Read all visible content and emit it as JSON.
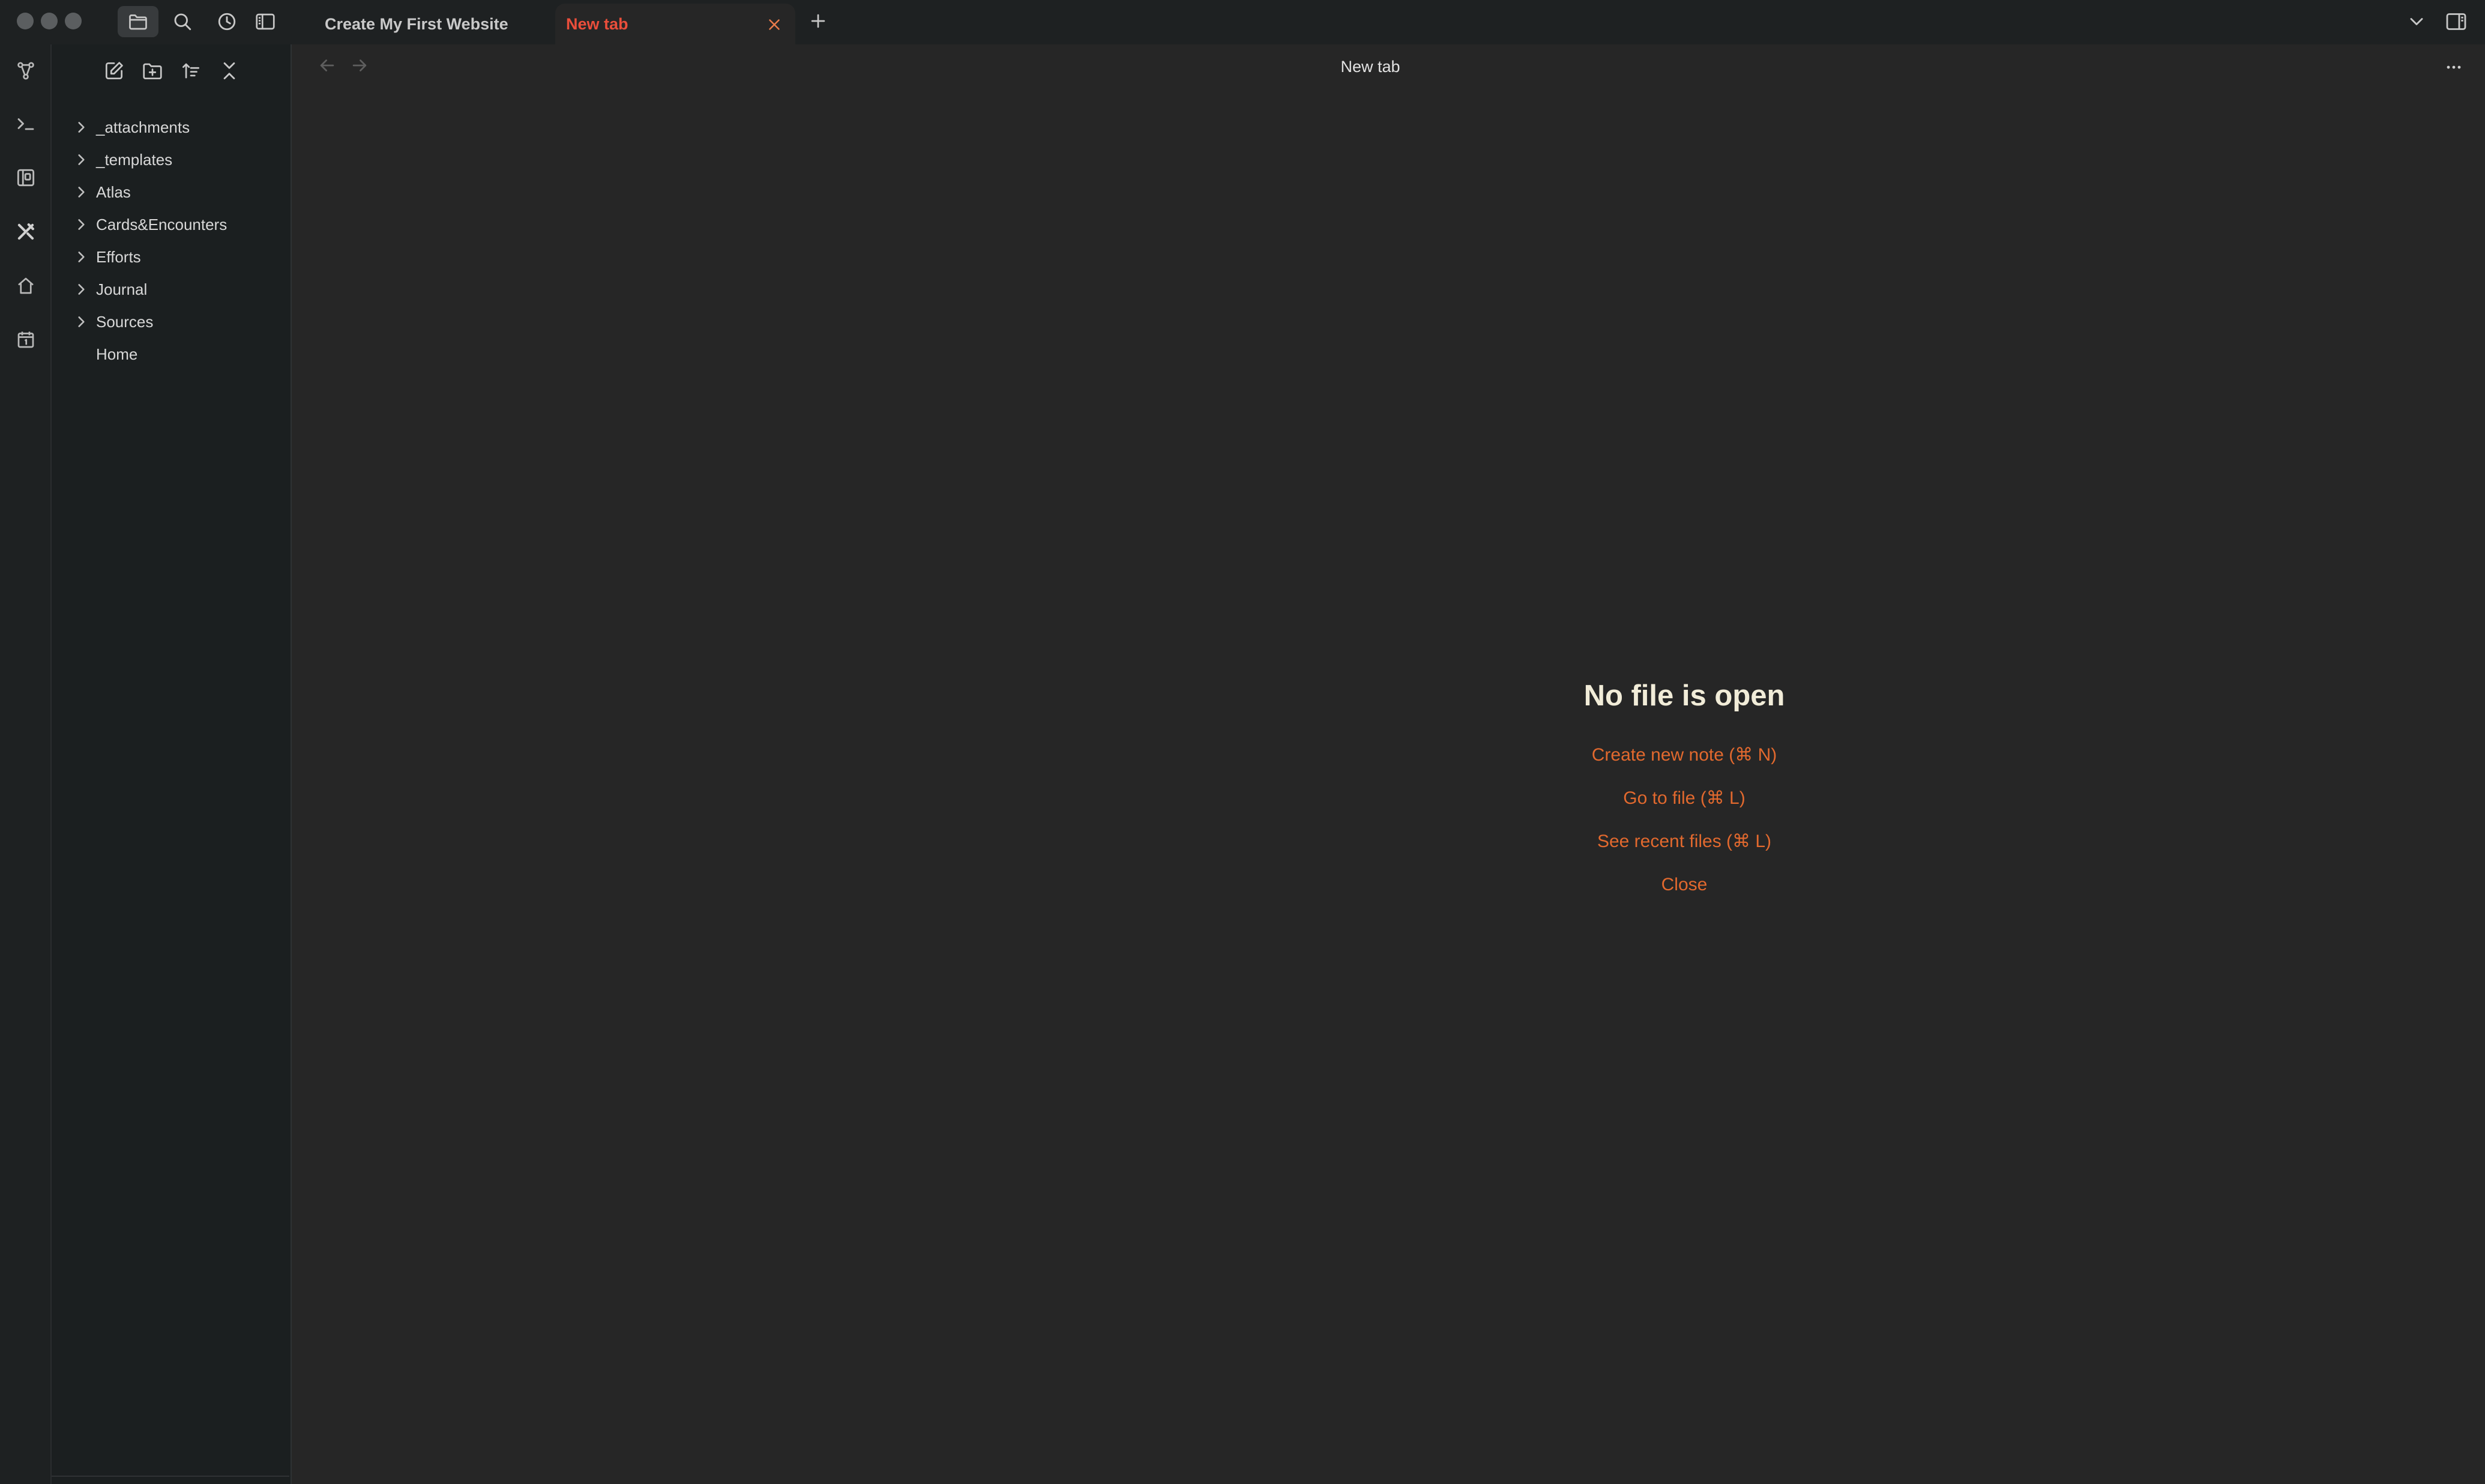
{
  "tabs": [
    {
      "label": "Create My First Website",
      "active": false
    },
    {
      "label": "New tab",
      "active": true
    }
  ],
  "titlebar_icons": [
    "files-icon",
    "search-icon",
    "recent-icon",
    "sidebar-layout-icon"
  ],
  "ribbon_icons": [
    "graph-icon",
    "terminal-icon",
    "canvas-icon",
    "tools-icon",
    "home-icon",
    "calendar-icon"
  ],
  "sidebar_tools": [
    "new-note-icon",
    "new-folder-icon",
    "sort-icon",
    "collapse-all-icon"
  ],
  "file_tree": [
    {
      "label": "_attachments",
      "type": "folder"
    },
    {
      "label": "_templates",
      "type": "folder"
    },
    {
      "label": "Atlas",
      "type": "folder"
    },
    {
      "label": "Cards&Encounters",
      "type": "folder"
    },
    {
      "label": "Efforts",
      "type": "folder"
    },
    {
      "label": "Journal",
      "type": "folder"
    },
    {
      "label": "Sources",
      "type": "folder"
    },
    {
      "label": "Home",
      "type": "file"
    }
  ],
  "view": {
    "title": "New tab"
  },
  "empty_state": {
    "title": "No file is open",
    "actions": [
      {
        "label": "Create new note (⌘ N)"
      },
      {
        "label": "Go to file (⌘ L)"
      },
      {
        "label": "See recent files (⌘ L)"
      },
      {
        "label": "Close"
      }
    ]
  },
  "colors": {
    "accent": "#e2692e",
    "active_tab_text": "#ea4e3b",
    "background": "#262626",
    "sidebar": "#1b1f20",
    "titlebar": "#1e2122"
  }
}
